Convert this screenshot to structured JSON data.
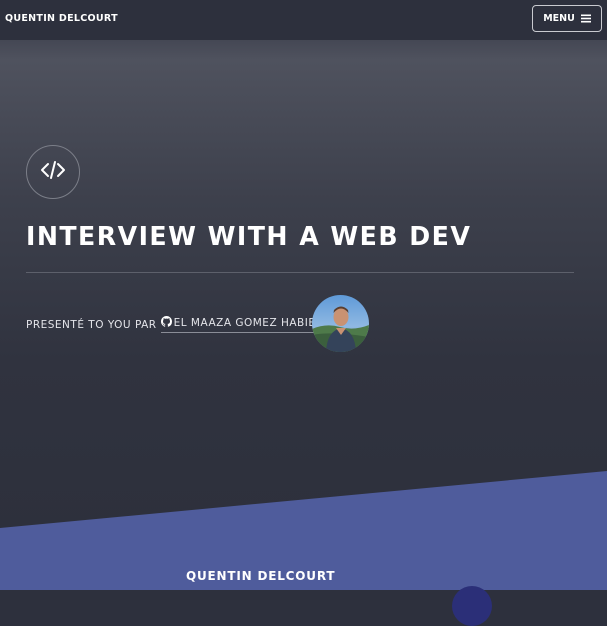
{
  "header": {
    "brand": "QUENTIN DELCOURT",
    "menu_label": "MENU"
  },
  "article": {
    "icon": "code-icon",
    "title": "INTERVIEW WITH A WEB DEV",
    "byline_prefix": "PRESENTÉ TO YOU PAR",
    "author_name": "EL MAAZA GOMEZ HABIB",
    "author_icon": "github-icon"
  },
  "footer": {
    "name": "QUENTIN DELCOURT"
  },
  "colors": {
    "background": "#2d303d",
    "accent": "#4f5c9c",
    "text": "#ffffff"
  }
}
